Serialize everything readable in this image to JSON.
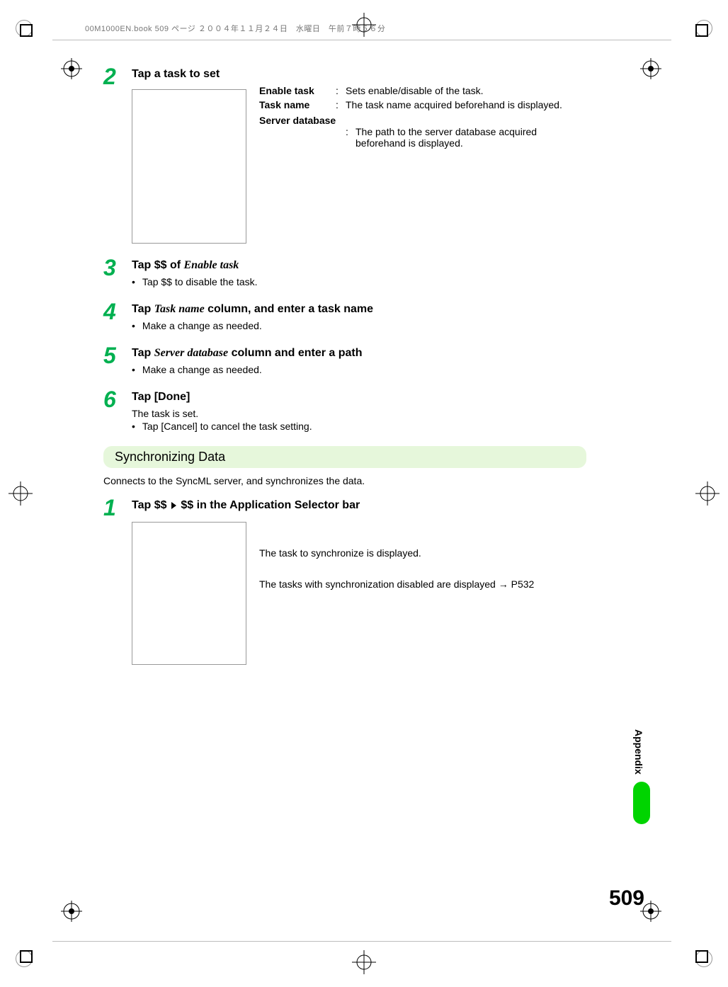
{
  "header_line": "00M1000EN.book  509 ページ  ２００４年１１月２４日　水曜日　午前７時５６分",
  "steps": {
    "s2": {
      "num": "2",
      "title": "Tap a task to set",
      "defs": {
        "enable_task_term": "Enable task",
        "enable_task_desc": "Sets enable/disable of the task.",
        "task_name_term": "Task name",
        "task_name_desc": "The task name acquired beforehand is displayed.",
        "server_db_term": "Server database",
        "server_db_desc": "The path to the server database acquired beforehand is displayed."
      }
    },
    "s3": {
      "num": "3",
      "title_pre": "Tap $$ of ",
      "title_ital": "Enable task",
      "bullet": "Tap $$ to disable the task."
    },
    "s4": {
      "num": "4",
      "title_pre": "Tap ",
      "title_ital": "Task name",
      "title_post": " column, and enter a task name",
      "bullet": "Make a change as needed."
    },
    "s5": {
      "num": "5",
      "title_pre": "Tap ",
      "title_ital": "Server database",
      "title_post": " column and enter a path",
      "bullet": "Make a change as needed."
    },
    "s6": {
      "num": "6",
      "title": "Tap [Done]",
      "line": "The task is set.",
      "bullet": "Tap [Cancel] to cancel the task setting."
    }
  },
  "section": {
    "heading": "Synchronizing Data",
    "desc": "Connects to the SyncML server, and synchronizes the data."
  },
  "steps2": {
    "s1": {
      "num": "1",
      "title_pre": "Tap $$ ",
      "title_post": " $$ in the Application Selector bar",
      "line1": "The task to synchronize is displayed.",
      "line2_pre": "The tasks with synchronization disabled are displayed ",
      "line2_arrow": "→",
      "line2_post": " P532"
    }
  },
  "side_tab": "Appendix",
  "page_number": "509"
}
